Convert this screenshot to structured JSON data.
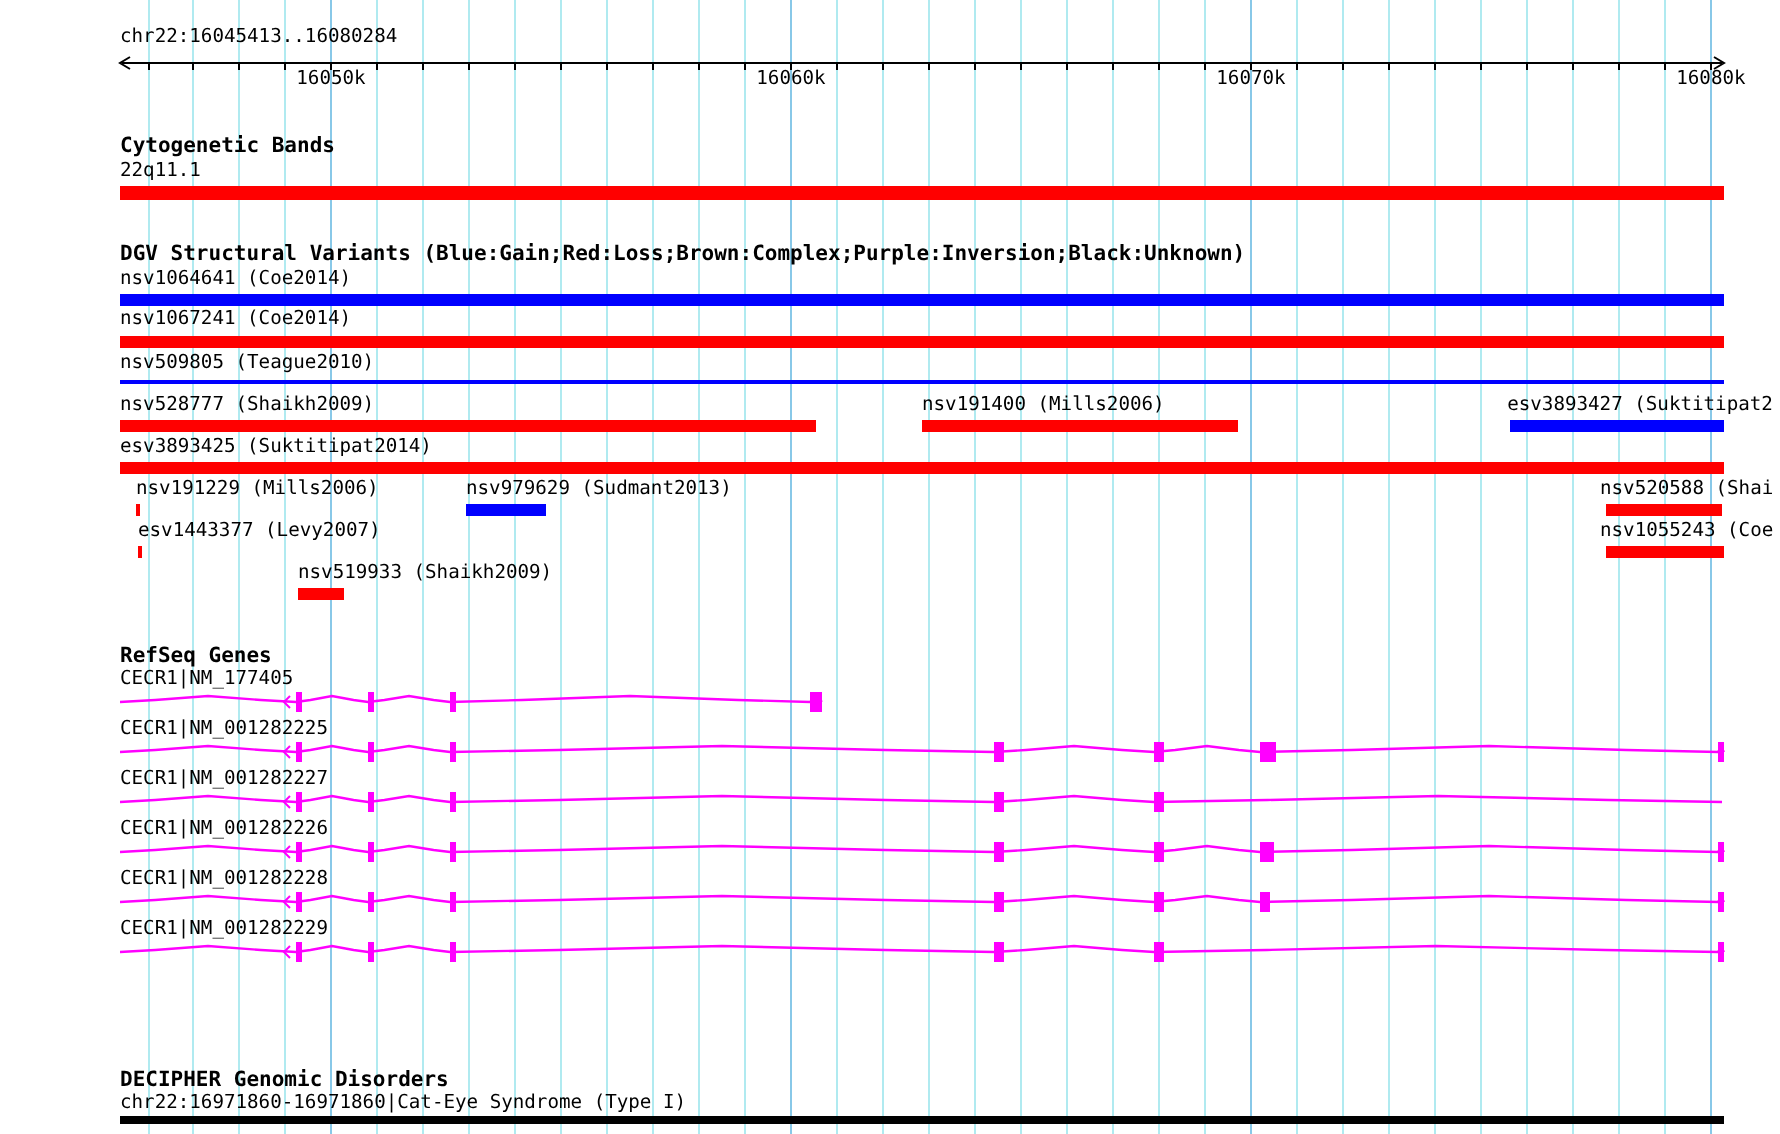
{
  "location": "chr22:16045413..16080284",
  "ruler": {
    "ticks": [
      "16050k",
      "16060k",
      "16070k",
      "16080k"
    ]
  },
  "tracks": [
    {
      "kind": "bands",
      "title": "Cytogenetic Bands",
      "features": [
        {
          "label": "22q11.1",
          "color": "#ff0000"
        }
      ]
    },
    {
      "kind": "variants",
      "title": "DGV Structural Variants (Blue:Gain;Red:Loss;Brown:Complex;Purple:Inversion;Black:Unknown)",
      "features": [
        {
          "label": "nsv1064641 (Coe2014)",
          "color": "#0000ff"
        },
        {
          "label": "nsv1067241 (Coe2014)",
          "color": "#ff0000"
        },
        {
          "label": "nsv509805 (Teague2010)",
          "color": "#0000ff"
        },
        {
          "label": "nsv528777 (Shaikh2009)",
          "color": "#ff0000"
        },
        {
          "label": "nsv191400 (Mills2006)",
          "color": "#ff0000"
        },
        {
          "label": "esv3893427 (Suktitipat2",
          "color": "#0000ff"
        },
        {
          "label": "esv3893425 (Suktitipat2014)",
          "color": "#ff0000"
        },
        {
          "label": "nsv191229 (Mills2006)",
          "color": "#ff0000"
        },
        {
          "label": "nsv979629 (Sudmant2013)",
          "color": "#0000ff"
        },
        {
          "label": "nsv520588 (Shai",
          "color": "#ff0000"
        },
        {
          "label": "esv1443377 (Levy2007)",
          "color": "#ff0000"
        },
        {
          "label": "nsv1055243 (Coe",
          "color": "#ff0000"
        },
        {
          "label": "nsv519933 (Shaikh2009)",
          "color": "#ff0000"
        }
      ]
    },
    {
      "kind": "genes",
      "title": "RefSeq Genes",
      "features": [
        {
          "label": "CECR1|NM_177405"
        },
        {
          "label": "CECR1|NM_001282225"
        },
        {
          "label": "CECR1|NM_001282227"
        },
        {
          "label": "CECR1|NM_001282226"
        },
        {
          "label": "CECR1|NM_001282228"
        },
        {
          "label": "CECR1|NM_001282229"
        }
      ]
    },
    {
      "kind": "disorders",
      "title": "DECIPHER Genomic Disorders",
      "features": [
        {
          "label": "chr22:16971860-16971860|Cat-Eye Syndrome (Type I)",
          "color": "#000000"
        }
      ]
    }
  ]
}
